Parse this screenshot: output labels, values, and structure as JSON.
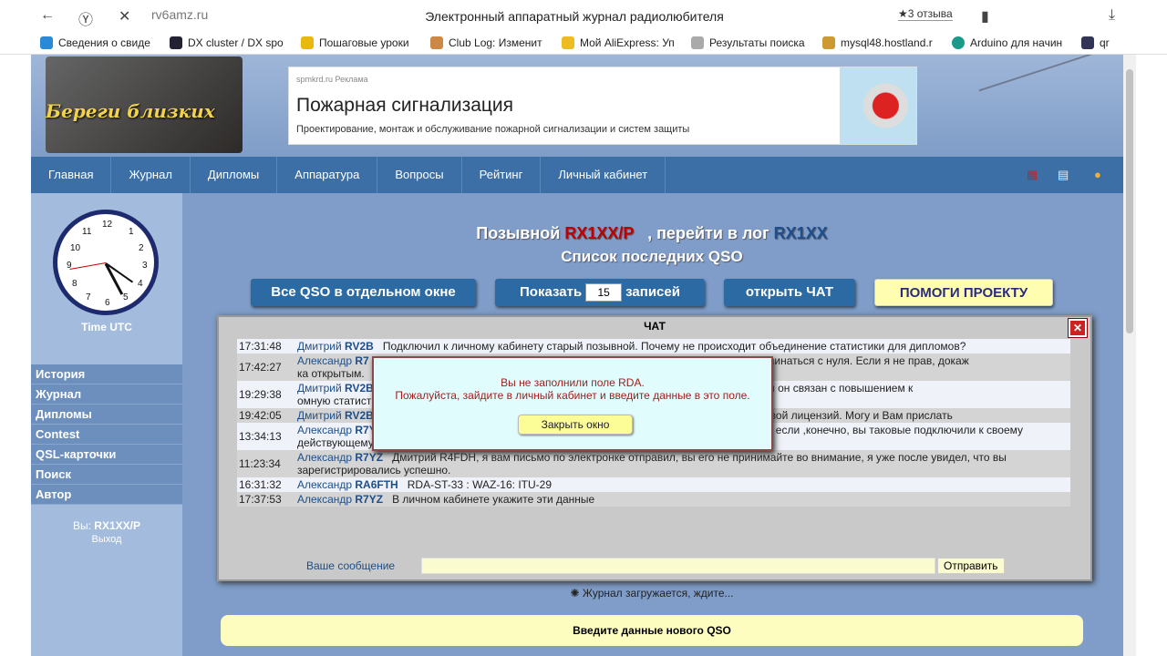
{
  "browser": {
    "url": "rv6amz.ru",
    "title": "Электронный аппаратный журнал радиолюбителя",
    "reviews": "★3 отзыва",
    "bookmarks": [
      "Сведения о свиде",
      "DX cluster / DX spo",
      "Пошаговые уроки",
      "Club Log: Изменит",
      "Мой AliExpress: Уп",
      "Результаты поиска",
      "mysql48.hostland.r",
      "Arduino для начин",
      "qr"
    ]
  },
  "ad": {
    "source": "spmkrd.ru",
    "label": "Реклама",
    "headline": "Пожарная сигнализация",
    "text": "Проектирование, монтаж и обслуживание пожарной сигнализации и систем защиты"
  },
  "logo": "Береги близких",
  "nav": [
    "Главная",
    "Журнал",
    "Дипломы",
    "Аппаратура",
    "Вопросы",
    "Рейтинг",
    "Личный кабинет"
  ],
  "clock": {
    "numbers": [
      "12",
      "1",
      "2",
      "3",
      "4",
      "5",
      "6",
      "7",
      "8",
      "9",
      "10",
      "11"
    ],
    "label": "Time UTC"
  },
  "side_menu": [
    "История",
    "Журнал",
    "Дипломы",
    "Contest",
    "QSL-карточки",
    "Поиск",
    "Автор"
  ],
  "user": {
    "prefix": "Вы:",
    "call": "RX1XX/P",
    "logout": "Выход"
  },
  "heading": {
    "p1": "Позывной",
    "call": "RX1XX/P",
    "p2": ", перейти в лог",
    "log": "RX1XX",
    "sub": "Список последних QSO"
  },
  "buttons": {
    "all_qso": "Все QSO в отдельном окне",
    "show": "Показать",
    "count": "15",
    "records": "записей",
    "open_chat": "открыть ЧАТ",
    "help": "ПОМОГИ ПРОЕКТУ"
  },
  "chat": {
    "title": "ЧАТ",
    "close": "✕",
    "rows": [
      {
        "time": "17:31:48",
        "name": "Дмитрий",
        "call": "RV2B",
        "text": "Подключил к личному кабинету старый позывной. Почему не происходит объединение статистики для дипломов?"
      },
      {
        "time": "17:42:27",
        "name": "Александр",
        "call": "R7",
        "text": "                                                                              вого позывного все должно начинаться с нуля. Если я не прав, докаж                                                                                  ка открытым."
      },
      {
        "time": "19:29:38",
        "name": "Дмитрий",
        "call": "RV2B",
        "text": "                                                                          ого - это технический акт. У меня он связан с повышением к                                                                          омную статистику объединили. Поэтому удивлен вопросу."
      },
      {
        "time": "19:42:05",
        "name": "Дмитрий",
        "call": "RV2B",
        "text": "                                                                          или прислать копии старой и новой лицензий. Могу и Вам прислать"
      },
      {
        "time": "13:34:13",
        "name": "Александр",
        "call": "R7YZ",
        "text": "99% всех дипломов теперь поддерживают работу со старыми позывными, если ,конечно, вы таковые подключили к своему действующему позывному"
      },
      {
        "time": "11:23:34",
        "name": "Александр",
        "call": "R7YZ",
        "text": "Дмитрий R4FDH, я вам письмо по электронке отправил, вы его не принимайте во внимание, я уже после увидел, что вы зарегистрировались успешно."
      },
      {
        "time": "16:31:32",
        "name": "Александр",
        "call": "RA6FTH",
        "text": "RDA-ST-33 : WAZ-16: ITU-29"
      },
      {
        "time": "17:37:53",
        "name": "Александр",
        "call": "R7YZ",
        "text": "В личном кабинете укажите эти данные"
      }
    ],
    "message_label": "Ваше сообщение",
    "send": "Отправить"
  },
  "loading": "Журнал загружается, ждите...",
  "new_qso": "Введите данные нового QSO",
  "modal": {
    "line1": "Вы не заполнили поле RDA.",
    "line2": "Пожалуйста, зайдите в личный кабинет и введите данные в это поле.",
    "close": "Закрыть окно"
  }
}
